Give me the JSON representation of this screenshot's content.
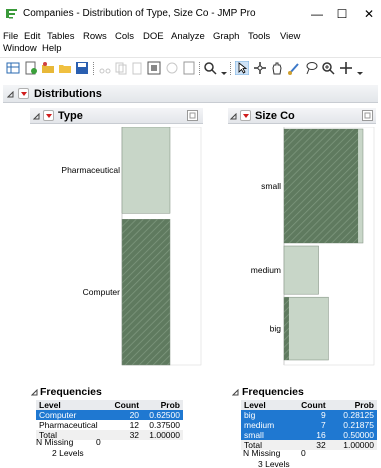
{
  "window": {
    "title": "Companies - Distribution of Type, Size Co - JMP Pro",
    "min_glyph": "—",
    "max_glyph": "☐",
    "close_glyph": "✕"
  },
  "menu": {
    "items": [
      "File",
      "Edit",
      "Tables",
      "Rows",
      "Cols",
      "DOE",
      "Analyze",
      "Graph",
      "Tools",
      "View",
      "Window",
      "Help"
    ]
  },
  "report": {
    "title": "Distributions",
    "type_panel": {
      "title": "Type",
      "bar_labels": [
        "Pharmaceutical",
        "Computer"
      ],
      "freq_title": "Frequencies",
      "headers": [
        "Level",
        "Count",
        "Prob"
      ],
      "rows": [
        {
          "level": "Computer",
          "count": "20",
          "prob": "0.62500"
        },
        {
          "level": "Pharmaceutical",
          "count": "12",
          "prob": "0.37500"
        },
        {
          "level": "Total",
          "count": "32",
          "prob": "1.00000"
        }
      ],
      "missing_label": "N Missing",
      "missing_value": "0",
      "levels_text": "2  Levels"
    },
    "size_panel": {
      "title": "Size Co",
      "bar_labels": [
        "small",
        "medium",
        "big"
      ],
      "freq_title": "Frequencies",
      "headers": [
        "Level",
        "Count",
        "Prob"
      ],
      "rows": [
        {
          "level": "big",
          "count": "9",
          "prob": "0.28125"
        },
        {
          "level": "medium",
          "count": "7",
          "prob": "0.21875"
        },
        {
          "level": "small",
          "count": "16",
          "prob": "0.50000"
        },
        {
          "level": "Total",
          "count": "32",
          "prob": "1.00000"
        }
      ],
      "missing_label": "N Missing",
      "missing_value": "0",
      "levels_text": "3  Levels"
    }
  },
  "chart_data": [
    {
      "type": "bar",
      "orientation": "horizontal",
      "categories": [
        "Pharmaceutical",
        "Computer"
      ],
      "values": [
        12,
        20
      ],
      "selected": [
        "Computer"
      ]
    },
    {
      "type": "bar",
      "orientation": "horizontal",
      "categories": [
        "small",
        "medium",
        "big"
      ],
      "values": [
        16,
        7,
        9
      ],
      "selected_portion": [
        15,
        0,
        1
      ]
    }
  ],
  "colors": {
    "bar_fill": "#c8d6c8",
    "bar_selected": "#5f7a5f",
    "selection": "#1f78d1",
    "close_red": "#d01c1c"
  }
}
